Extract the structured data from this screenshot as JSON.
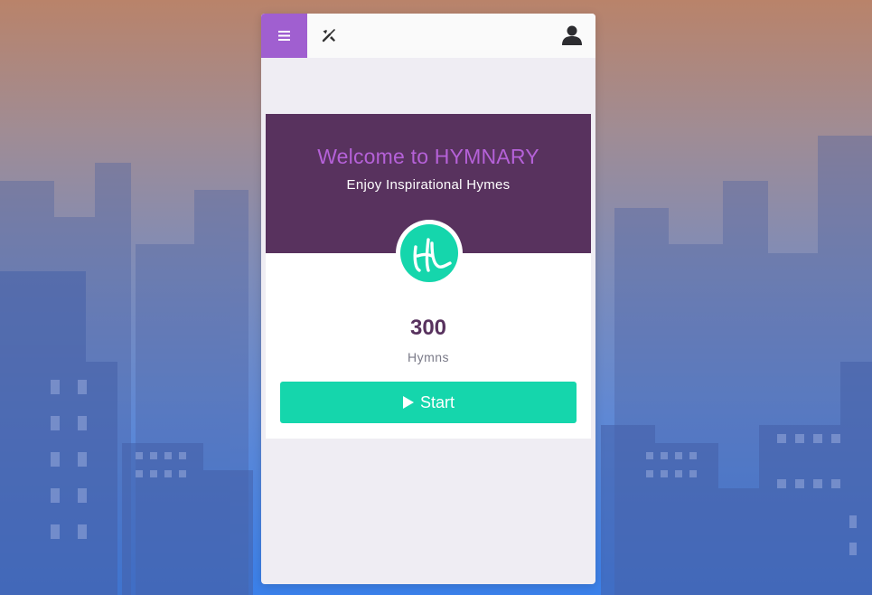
{
  "header": {
    "menu_icon": "menu-icon",
    "tools_icon": "tools-icon",
    "user_icon": "user-icon"
  },
  "welcome": {
    "title": "Welcome to HYMNARY",
    "subtitle": "Enjoy Inspirational Hymes",
    "logo_text": "HL"
  },
  "stats": {
    "count": "300",
    "label": "Hymns"
  },
  "start_button": {
    "label": "Start",
    "icon": "play-icon"
  },
  "colors": {
    "accent": "#a05fd0",
    "header_bg": "#58325e",
    "title": "#b561d8",
    "button": "#15d6ac"
  }
}
